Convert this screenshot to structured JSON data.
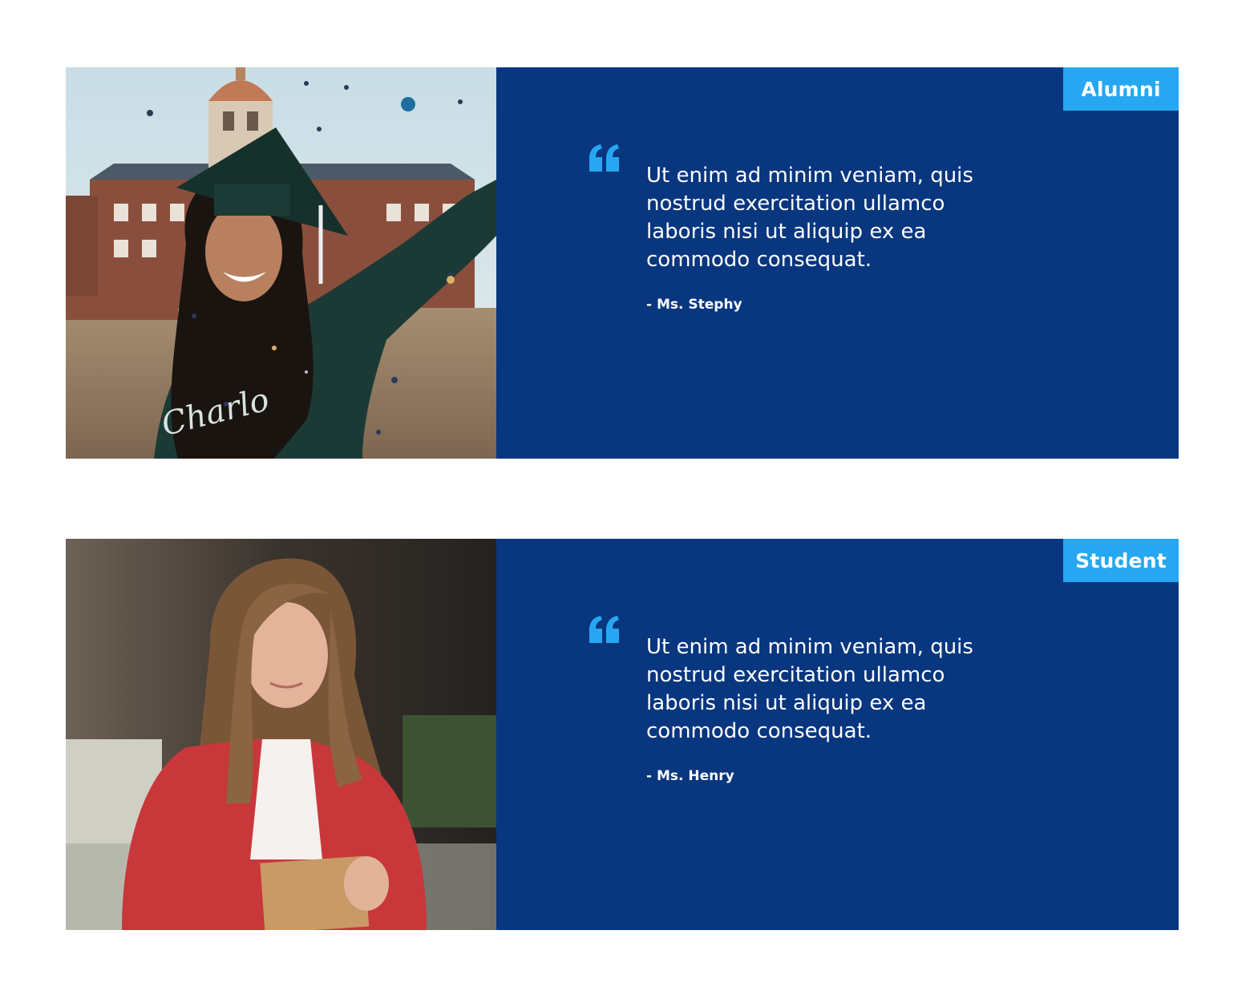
{
  "colors": {
    "panel_background": "#08367f",
    "tag_background": "#27a7f1",
    "quote_icon": "#27a7f1",
    "text": "#ffffff"
  },
  "testimonials": [
    {
      "tag": "Alumni",
      "quote": "Ut enim ad minim veniam, quis nostrud exercitation ullamco laboris nisi ut aliquip ex ea commodo consequat.",
      "author": "- Ms. Stephy",
      "photo_icon": "graduate-photo"
    },
    {
      "tag": "Student",
      "quote": "Ut enim ad minim veniam, quis nostrud exercitation ullamco laboris nisi ut aliquip ex ea commodo consequat.",
      "author": "- Ms. Henry",
      "photo_icon": "student-photo"
    }
  ]
}
